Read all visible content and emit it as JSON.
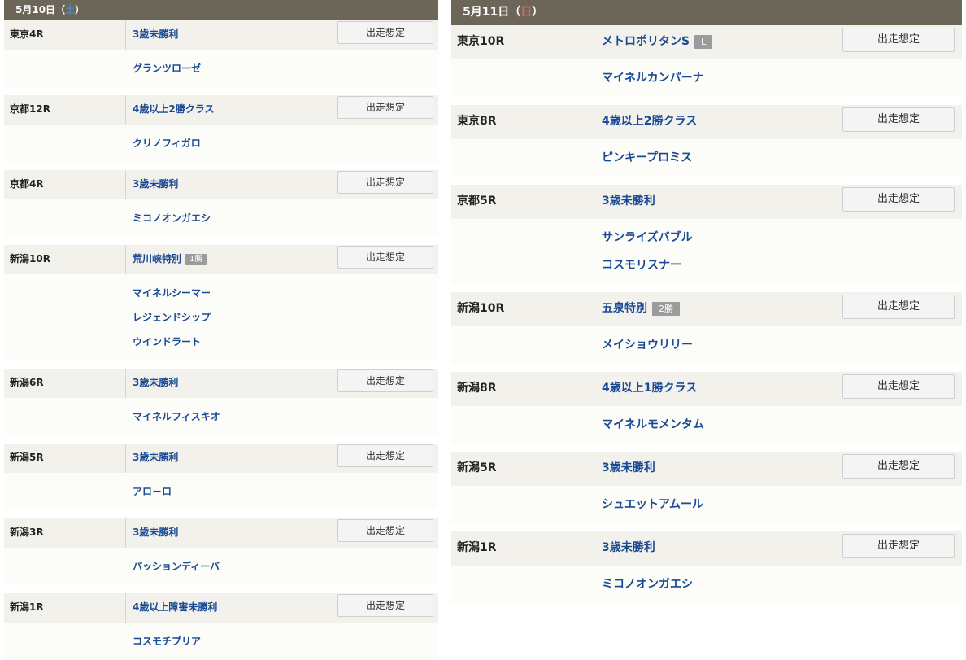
{
  "left": {
    "date": "5月10日",
    "dow_open": "（",
    "dow": "土",
    "dow_close": "）",
    "races": [
      {
        "venue": "東京4R",
        "name": "3歳未勝利",
        "badge": "",
        "button": "出走想定",
        "horses": [
          "グランツローゼ"
        ]
      },
      {
        "venue": "京都12R",
        "name": "4歳以上2勝クラス",
        "badge": "",
        "button": "出走想定",
        "horses": [
          "クリノフィガロ"
        ]
      },
      {
        "venue": "京都4R",
        "name": "3歳未勝利",
        "badge": "",
        "button": "出走想定",
        "horses": [
          "ミコノオンガエシ"
        ]
      },
      {
        "venue": "新潟10R",
        "name": "荒川峡特別",
        "badge": "1勝",
        "button": "出走想定",
        "horses": [
          "マイネルシーマー",
          "レジェンドシップ",
          "ウインドラート"
        ]
      },
      {
        "venue": "新潟6R",
        "name": "3歳未勝利",
        "badge": "",
        "button": "出走想定",
        "horses": [
          "マイネルフィスキオ"
        ]
      },
      {
        "venue": "新潟5R",
        "name": "3歳未勝利",
        "badge": "",
        "button": "出走想定",
        "horses": [
          "アロ－ロ"
        ]
      },
      {
        "venue": "新潟3R",
        "name": "3歳未勝利",
        "badge": "",
        "button": "出走想定",
        "horses": [
          "パッションディーバ"
        ]
      },
      {
        "venue": "新潟1R",
        "name": "4歳以上障害未勝利",
        "badge": "",
        "button": "出走想定",
        "horses": [
          "コスモチプリア"
        ]
      }
    ]
  },
  "right": {
    "date": "5月11日",
    "dow_open": "（",
    "dow": "日",
    "dow_close": "）",
    "races": [
      {
        "venue": "東京10R",
        "name": "メトロポリタンS",
        "badge": "L",
        "button": "出走想定",
        "horses": [
          "マイネルカンパーナ"
        ]
      },
      {
        "venue": "東京8R",
        "name": "4歳以上2勝クラス",
        "badge": "",
        "button": "出走想定",
        "horses": [
          "ピンキープロミス"
        ]
      },
      {
        "venue": "京都5R",
        "name": "3歳未勝利",
        "badge": "",
        "button": "出走想定",
        "horses": [
          "サンライズバブル",
          "コスモリスナー"
        ]
      },
      {
        "venue": "新潟10R",
        "name": "五泉特別",
        "badge": "2勝",
        "button": "出走想定",
        "horses": [
          "メイショウリリー"
        ]
      },
      {
        "venue": "新潟8R",
        "name": "4歳以上1勝クラス",
        "badge": "",
        "button": "出走想定",
        "horses": [
          "マイネルモメンタム"
        ]
      },
      {
        "venue": "新潟5R",
        "name": "3歳未勝利",
        "badge": "",
        "button": "出走想定",
        "horses": [
          "シュエットアムール"
        ]
      },
      {
        "venue": "新潟1R",
        "name": "3歳未勝利",
        "badge": "",
        "button": "出走想定",
        "horses": [
          "ミコノオンガエシ"
        ]
      }
    ]
  }
}
